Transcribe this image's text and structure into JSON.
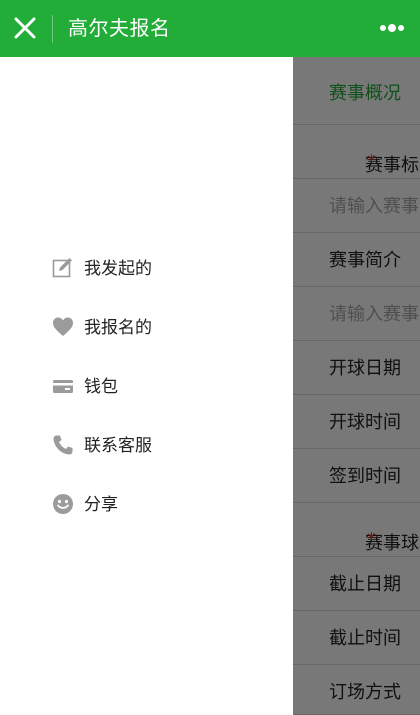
{
  "header": {
    "title": "高尔夫报名"
  },
  "drawer_menu": [
    {
      "label": "我发起的",
      "icon": "edit-icon"
    },
    {
      "label": "我报名的",
      "icon": "heart-icon"
    },
    {
      "label": "钱包",
      "icon": "wallet-icon"
    },
    {
      "label": "联系客服",
      "icon": "phone-icon"
    },
    {
      "label": "分享",
      "icon": "smile-icon"
    }
  ],
  "form": {
    "section_title": "赛事概况",
    "event_title_label": "赛事标题",
    "event_title_placeholder": "请输入赛事",
    "event_intro_label": "赛事简介",
    "event_intro_placeholder": "请输入赛事",
    "tee_date_label": "开球日期",
    "tee_time_label": "开球时间",
    "checkin_time_label": "签到时间",
    "course_label": "赛事球场",
    "deadline_date_label": "截止日期",
    "deadline_time_label": "截止时间",
    "booking_method_label": "订场方式",
    "required_mark": "*"
  },
  "colors": {
    "brand_green": "#22ac38",
    "overlay": "rgba(0,0,0,0.53)",
    "required": "#e43a3a"
  }
}
